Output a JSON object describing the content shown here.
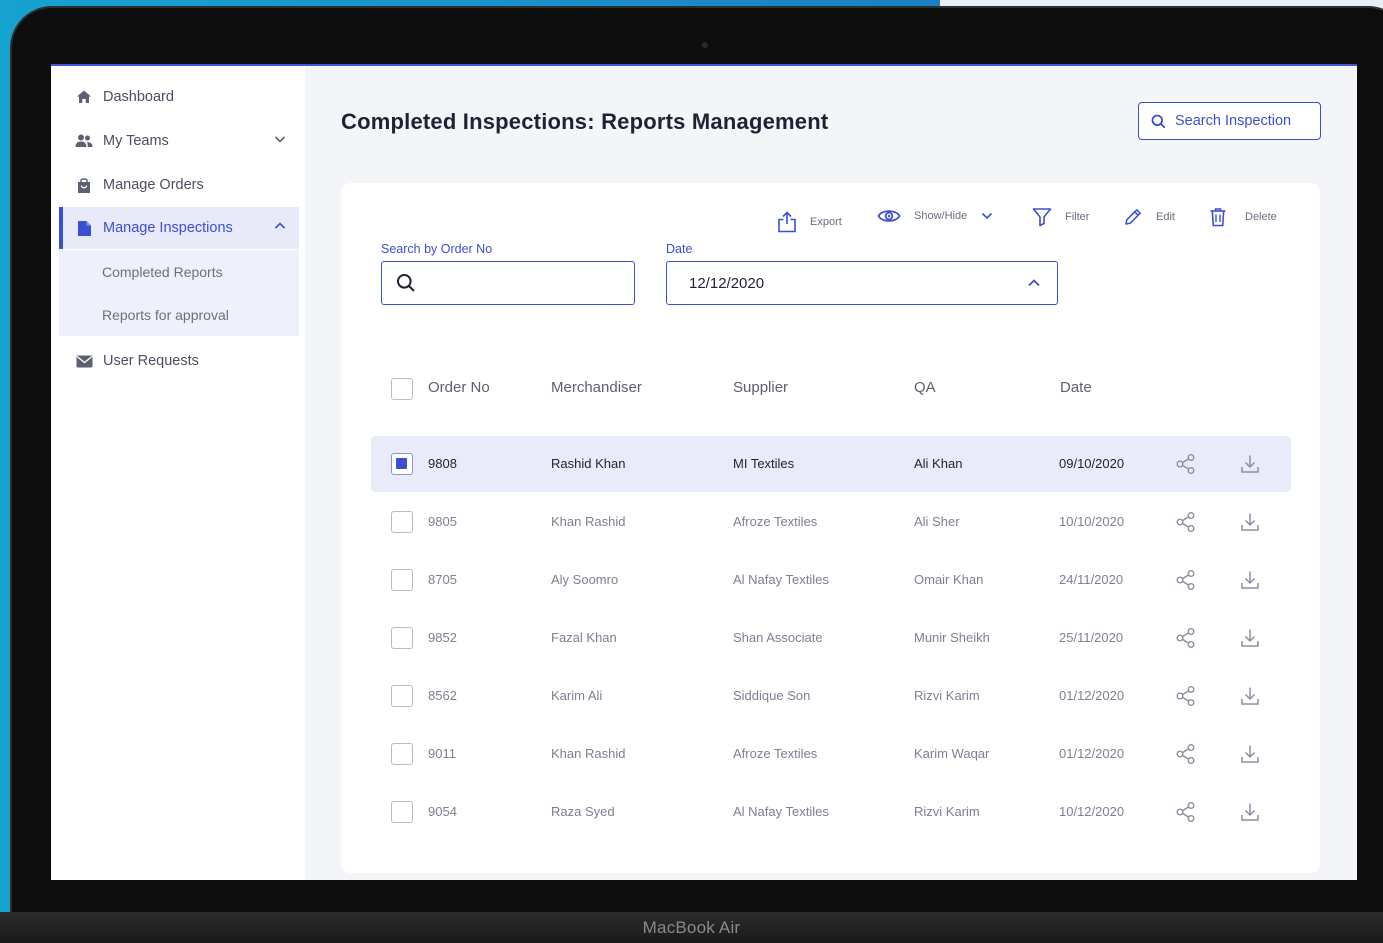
{
  "device": {
    "label": "MacBook Air"
  },
  "sidebar": {
    "items": [
      {
        "label": "Dashboard",
        "icon": "home-icon"
      },
      {
        "label": "My Teams",
        "icon": "users-icon"
      },
      {
        "label": "Manage Orders",
        "icon": "shopping-bag-icon"
      },
      {
        "label": "Manage Inspections",
        "icon": "document-icon",
        "active": true
      },
      {
        "label": "User Requests",
        "icon": "mail-icon"
      }
    ],
    "sub_items": [
      {
        "label": "Completed Reports"
      },
      {
        "label": "Reports for approval"
      }
    ]
  },
  "header": {
    "title": "Completed Inspections: Reports Management",
    "search_button": "Search Inspection"
  },
  "toolbar": {
    "export": "Export",
    "show_hide": "Show/Hide",
    "filter": "Filter",
    "edit": "Edit",
    "delete": "Delete"
  },
  "filters": {
    "order_label": "Search by Order No",
    "order_value": "",
    "date_label": "Date",
    "date_value": "12/12/2020"
  },
  "table": {
    "columns": [
      "Order No",
      "Merchandiser",
      "Supplier",
      "QA",
      "Date"
    ],
    "rows": [
      {
        "order": "9808",
        "merchandiser": "Rashid Khan",
        "supplier": "MI Textiles",
        "qa": "Ali Khan",
        "date": "09/10/2020",
        "selected": true
      },
      {
        "order": "9805",
        "merchandiser": "Khan Rashid",
        "supplier": "Afroze Textiles",
        "qa": "Ali Sher",
        "date": "10/10/2020",
        "selected": false
      },
      {
        "order": "8705",
        "merchandiser": "Aly Soomro",
        "supplier": "Al Nafay Textiles",
        "qa": "Omair Khan",
        "date": "24/11/2020",
        "selected": false
      },
      {
        "order": "9852",
        "merchandiser": "Fazal Khan",
        "supplier": "Shan  Associate",
        "qa": "Munir Sheikh",
        "date": "25/11/2020",
        "selected": false
      },
      {
        "order": "8562",
        "merchandiser": "Karim Ali",
        "supplier": "Siddique Son",
        "qa": "Rizvi Karim",
        "date": "01/12/2020",
        "selected": false
      },
      {
        "order": "9011",
        "merchandiser": "Khan Rashid",
        "supplier": "Afroze Textiles",
        "qa": "Karim Waqar",
        "date": "01/12/2020",
        "selected": false
      },
      {
        "order": "9054",
        "merchandiser": "Raza Syed",
        "supplier": "Al Nafay Textiles",
        "qa": "Rizvi Karim",
        "date": "10/12/2020",
        "selected": false
      }
    ]
  },
  "colors": {
    "accent": "#3c4fd0",
    "selected_row": "#e9ebfa",
    "background_left": "#16a3cf",
    "background_right": "#1a6fb8"
  }
}
